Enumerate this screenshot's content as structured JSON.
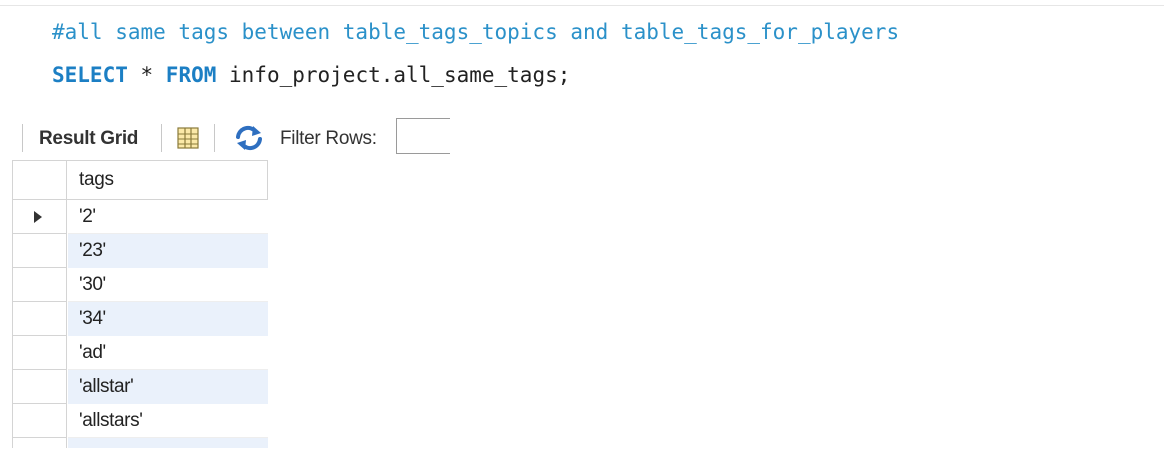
{
  "editor": {
    "comment_line": "#all same tags between table_tags_topics and table_tags_for_players",
    "query": {
      "kw_select": "SELECT",
      "star": " * ",
      "kw_from": "FROM",
      "target": " info_project.all_same_tags;"
    }
  },
  "result_toolbar": {
    "result_grid_label": "Result Grid",
    "filter_rows_label": "Filter Rows:",
    "filter_value": "",
    "icons": [
      "grid-layout-icon",
      "refresh-icon"
    ]
  },
  "result_grid": {
    "columns": [
      "tags"
    ],
    "rows": [
      "'2'",
      "'23'",
      "'30'",
      "'34'",
      "'ad'",
      "'allstar'",
      "'allstars'"
    ],
    "selected_row": 0
  },
  "colors": {
    "comment": "#2b91c9",
    "keyword": "#1c7fc4",
    "alt_row": "#eaf1fb",
    "grid_border": "#d4d4d4"
  }
}
